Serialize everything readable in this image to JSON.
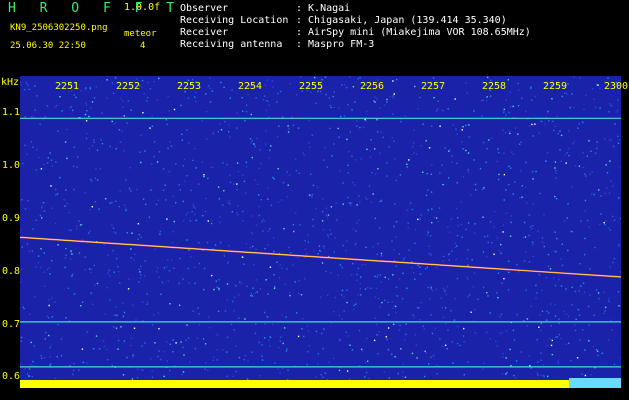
{
  "header": {
    "logo": "H R O F F T",
    "version": "1.0.0f",
    "filename": "KN9_2506302250.png",
    "mode": "meteor",
    "datetime": "25.06.30 22:50",
    "count": "4",
    "info": [
      {
        "label": "Observer",
        "value": ": K.Nagai"
      },
      {
        "label": "Receiving Location",
        "value": ": Chigasaki, Japan (139.414 35.340)"
      },
      {
        "label": "Receiver",
        "value": ": AirSpy mini (Miakejima VOR 108.65MHz)"
      },
      {
        "label": "Receiving antenna",
        "value": ": Maspro FM-3"
      }
    ]
  },
  "chart_data": {
    "type": "heatmap",
    "ylabel": "kHz",
    "y_ticks": [
      "1.1",
      "1.0",
      "0.9",
      "0.8",
      "0.7",
      "0.6"
    ],
    "x_ticks": [
      "2251",
      "2252",
      "2253",
      "2254",
      "2255",
      "2256",
      "2257",
      "2258",
      "2259",
      "2300"
    ],
    "y_range": [
      0.58,
      1.17
    ],
    "lines": [
      {
        "freq": 1.09
      },
      {
        "freq": 0.705
      },
      {
        "freq": 0.62
      }
    ],
    "trace": {
      "start": [
        0,
        0.865
      ],
      "end": [
        1,
        0.79
      ]
    },
    "colors": {
      "bg": "#1a22aa",
      "signal": "#ffff00",
      "line": "#40e0d0"
    }
  }
}
